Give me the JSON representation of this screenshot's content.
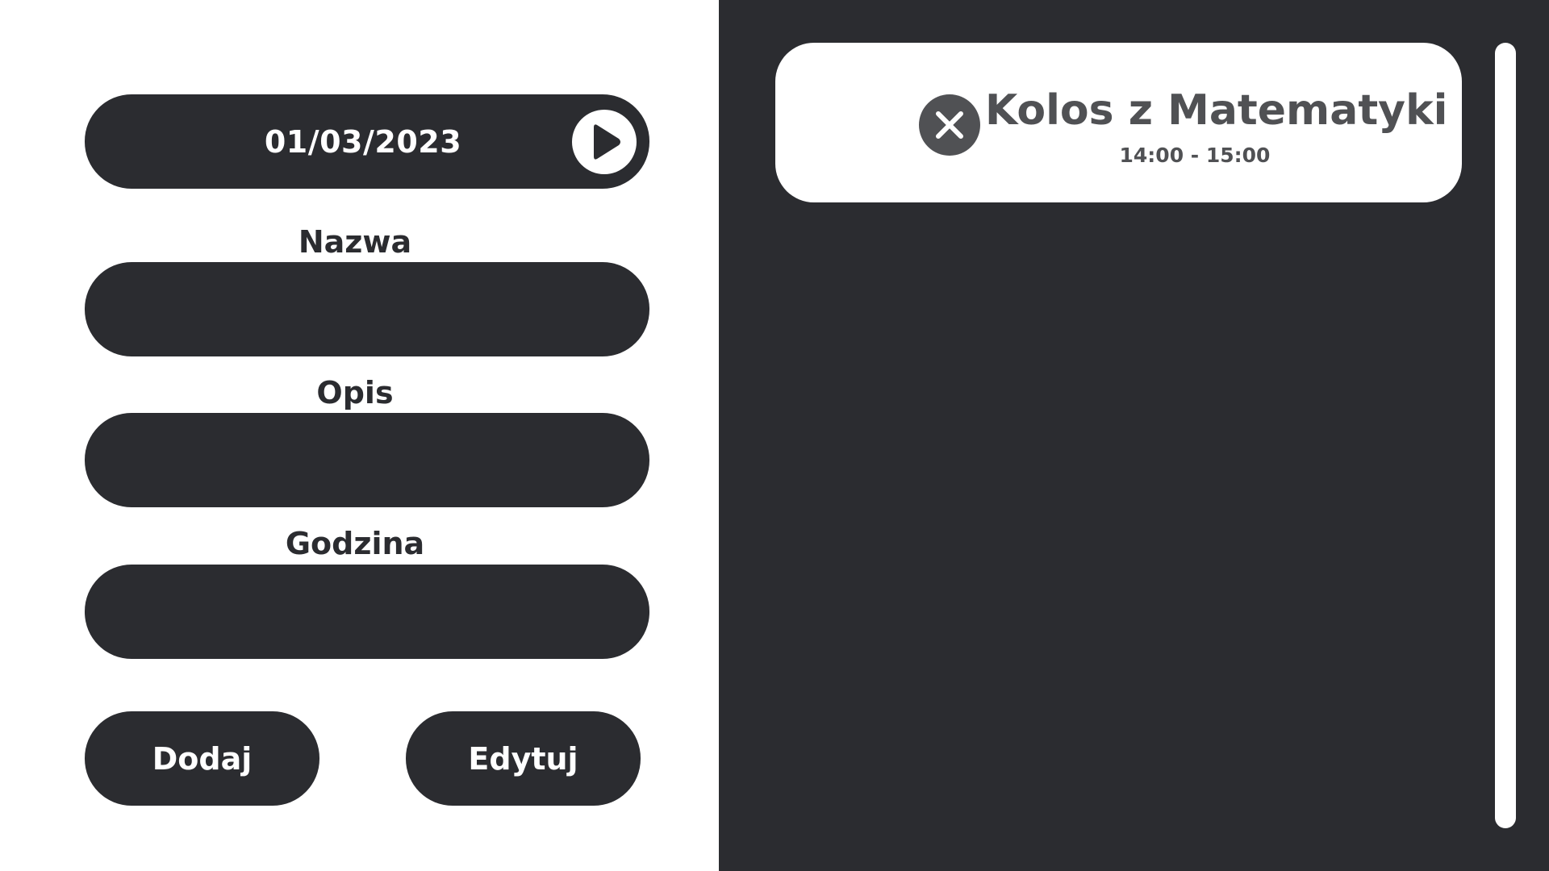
{
  "form": {
    "date": "01/03/2023",
    "next_icon": "play-triangle-icon",
    "fields": {
      "name_label": "Nazwa",
      "name_value": "",
      "description_label": "Opis",
      "description_value": "",
      "time_label": "Godzina",
      "time_value": ""
    },
    "buttons": {
      "add_label": "Dodaj",
      "edit_label": "Edytuj"
    }
  },
  "events": [
    {
      "title": "Kolos z Matematyki",
      "time": "14:00 - 15:00",
      "delete_icon": "close-circle-icon"
    }
  ],
  "colors": {
    "dark": "#2b2c30",
    "light": "#ffffff",
    "muted": "#505154"
  }
}
